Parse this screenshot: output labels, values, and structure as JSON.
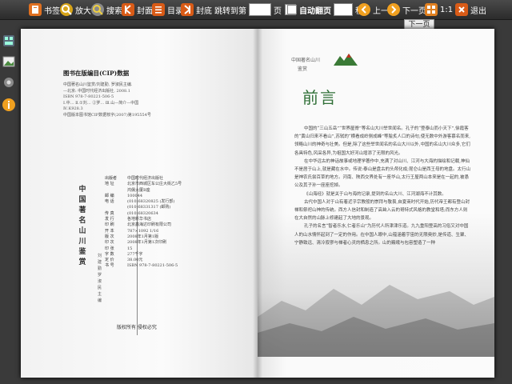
{
  "toolbar": {
    "bookmark_label": "书签",
    "zoom_label": "放大",
    "search_label": "搜索",
    "cover_label": "封面",
    "toc_label": "目录",
    "back_cover_label": "封底",
    "goto_label": "跳转到第",
    "goto_value": "",
    "goto_unit": "页",
    "autoflip_label": "自动翻页",
    "autoflip_seconds": "",
    "autoflip_unit": "秒",
    "prev_label": "上一页",
    "next_label": "下一页",
    "ratio_label": "1:1",
    "exit_label": "退出"
  },
  "tooltip": {
    "text": "下一页"
  },
  "left_page": {
    "cip_title": "图书在版编目(CIP)数据",
    "cip_lines": [
      "中国著名山川鉴赏/刘建勤, 罗淑民主编.",
      "—北京: 中国时代经济出版社, 2008.1",
      "ISBN 978-7-80221-506-5",
      "Ⅰ.中… Ⅱ.①刘… ②罗… Ⅲ.山—简介—中国",
      "Ⅳ.K928.3",
      "中国版本图书馆CIP数据核字(2007)第195554号"
    ],
    "vertical_title": "中国著名山川鉴赏",
    "vertical_author": "刘建勤 罗淑民 主编",
    "pub_rows": [
      {
        "k": "出版者",
        "v": "中国时代经济出版社"
      },
      {
        "k": "地 址",
        "v": "北京市西城区车公庄大街乙5号"
      },
      {
        "k": "",
        "v": "鸿儒大厦B座"
      },
      {
        "k": "邮 编",
        "v": "100044"
      },
      {
        "k": "电 话",
        "v": "(010)68320825 (发行部)"
      },
      {
        "k": "",
        "v": "(010)68331317 (邮购)"
      },
      {
        "k": "传 真",
        "v": "(010)68320634"
      },
      {
        "k": "发 行",
        "v": "各地新华书店"
      },
      {
        "k": "印 刷",
        "v": "北京鑫海达印刷有限公司"
      },
      {
        "k": "开 本",
        "v": "787×1092 1/16"
      },
      {
        "k": "版 次",
        "v": "2008年1月第1版"
      },
      {
        "k": "印 次",
        "v": "2008年1月第1次印刷"
      },
      {
        "k": "印 张",
        "v": "15"
      },
      {
        "k": "字 数",
        "v": "277千字"
      },
      {
        "k": "定 价",
        "v": "38.00元"
      },
      {
        "k": "书 号",
        "v": "ISBN 978-7-80221-506-5"
      }
    ],
    "copyright": "版权所有  侵权必究"
  },
  "right_page": {
    "brand_line1": "中国著名山川",
    "brand_line2": "鉴赏",
    "heading": "前言",
    "paragraphs": [
      "中国的“三山五岳”“世界屋脊”等名山大川举世闻名。孔子的“登泰山而小天下”,徐霞客的“黄山归来不看山”,苏轼的“横看成岭侧成峰”等脍炙人口的诗句,使无数中外游客慕名而来,领略山川的神奇与壮美。但是,除了这些举世闻名的名山大川以外,中国的名山大川众多,它们各具特色,风采各异,为祖国大好河山增添了无限的风光。",
      "在中华远古的神话故事或地理学著作中,充满了对山川、江河与大海的描绘和记载,神仙不是居于山上,就是藏在水中。传说:泰山是盘古的头颅化成;昆仑山是西王母的地盘。太行山是神农氏尝百草的地方。河南、陕西交界处有一座华山,太行王屋两山本来是在一起的,被愚公及其子孙一座座挖掉。",
      "《山海经》就是关于山与海的记录,提到的名山大川、江河湖海不计其数。",
      "古代中国人对于山有着近乎宗教般的崇拜与敬畏,自夏商时代开始,历代帝王都有登山封禅和祭祀山神的传统。西方人信封和制造了高耸入云的哥特式风格的教堂和塔;而东方人则在大自然的山脉上修建起了大地的景观。",
      "孔子的名言“智者乐水,仁者乐山”为历代人所津津乐道。九九重阳登高的习俗又对中国人的山水情怀起到了一定的作用。在中国人眼中,山蕴涵着宇宙的无限奥妙,是传道、生聚、宁静致远、清冷寂寥与禅者心灵的栖息之所。山的巍峨与包容塑造了一种"
    ]
  },
  "colors": {
    "toolbar_bg": "#2b2b2b",
    "heading_green": "#2f6f36"
  },
  "icons": [
    "bookmark-icon",
    "zoom-icon",
    "search-icon",
    "cover-icon",
    "toc-icon",
    "back-cover-icon",
    "play-icon",
    "prev-icon",
    "next-icon",
    "ratio-icon",
    "exit-icon",
    "thumbnail-icon",
    "image-icon",
    "settings-icon",
    "info-icon"
  ]
}
